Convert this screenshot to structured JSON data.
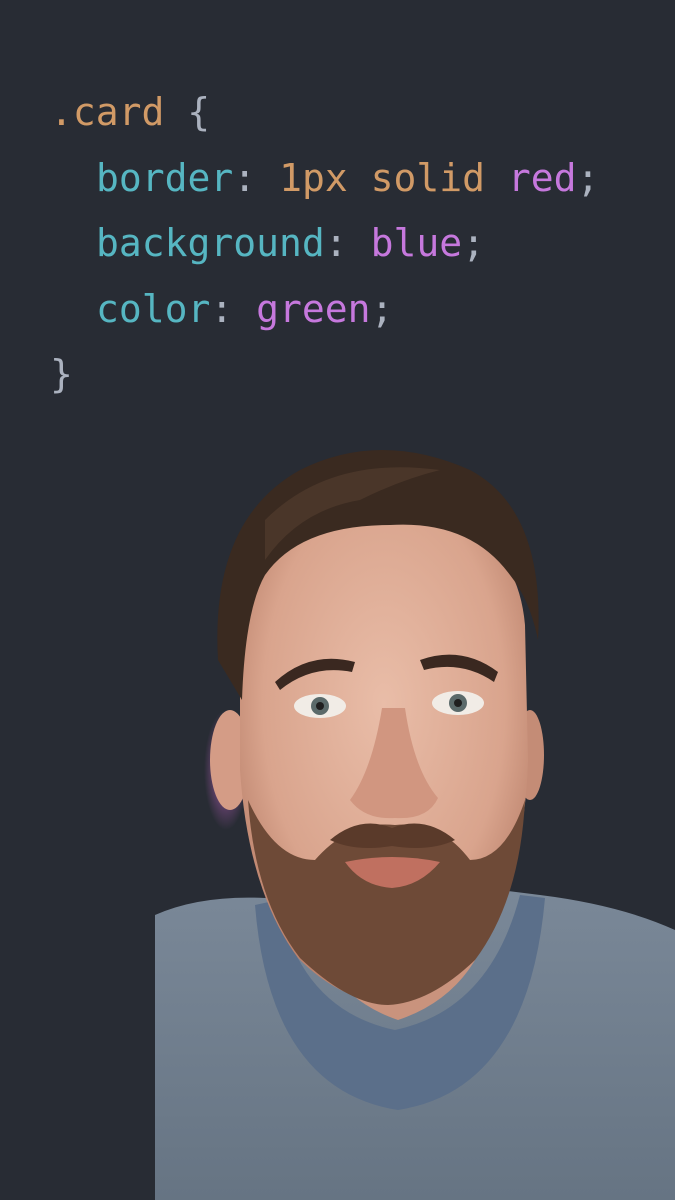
{
  "code": {
    "selector": ".card",
    "open_brace": "{",
    "close_brace": "}",
    "colon": ":",
    "semicolon": ";",
    "space": " ",
    "lines": [
      {
        "property": "border",
        "values": [
          {
            "text": "1px",
            "kind": "number"
          },
          {
            "text": "solid",
            "kind": "number"
          },
          {
            "text": "red",
            "kind": "keyword"
          }
        ]
      },
      {
        "property": "background",
        "values": [
          {
            "text": "blue",
            "kind": "keyword"
          }
        ]
      },
      {
        "property": "color",
        "values": [
          {
            "text": "green",
            "kind": "keyword"
          }
        ]
      }
    ]
  },
  "colors": {
    "editor_background": "#282c34",
    "selector": "#d19a66",
    "property": "#56b6c2",
    "number": "#d19a66",
    "keyword": "#c678dd",
    "punctuation": "#abb2bf",
    "shirt": "#6f7d8c",
    "skin": "#e2b39f",
    "hair": "#3b2a20"
  },
  "overlay": {
    "icon": "presenter-webcam-cutout"
  }
}
